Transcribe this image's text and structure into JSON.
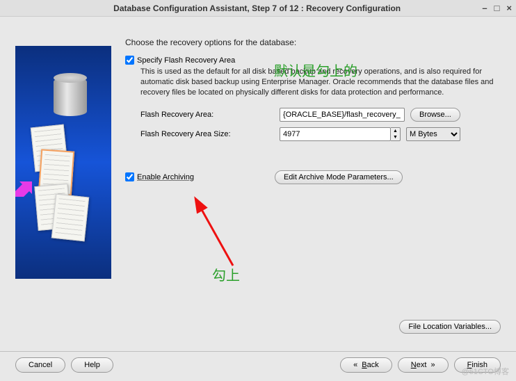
{
  "titlebar": {
    "title": "Database Configuration Assistant, Step 7 of 12 : Recovery Configuration"
  },
  "heading": "Choose the recovery options for the database:",
  "specify": {
    "label": "Specify Flash Recovery Area",
    "desc": "This is used as the default for all disk based backup and recovery operations, and is also required for automatic disk based backup using Enterprise Manager. Oracle recommends that the database files and recovery files be located on physically different disks for data protection and performance."
  },
  "fields": {
    "fra_label": "Flash Recovery Area:",
    "fra_value": "{ORACLE_BASE}/flash_recovery_",
    "browse": "Browse...",
    "fra_size_label": "Flash Recovery Area Size:",
    "fra_size_value": "4977",
    "size_unit": "M Bytes"
  },
  "archive": {
    "label": "Enable Archiving",
    "edit_params": "Edit Archive Mode Parameters..."
  },
  "file_loc_btn": "File Location Variables...",
  "nav": {
    "cancel": "Cancel",
    "help": "Help",
    "back": "Back",
    "next": "Next",
    "finish": "Finish"
  },
  "overlays": {
    "text1": "默认是勾上的",
    "text2": "勾上"
  },
  "watermark": "@51CTO博客"
}
